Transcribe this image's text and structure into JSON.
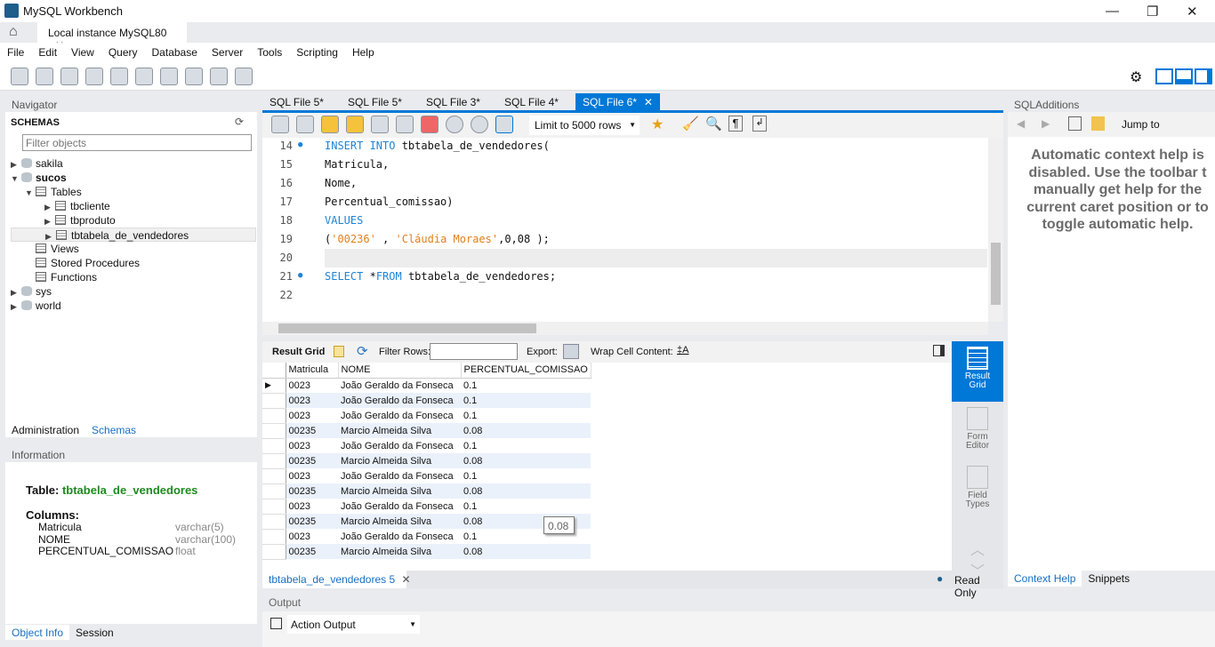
{
  "app": {
    "title": "MySQL Workbench",
    "connection_tab": "Local instance MySQL80"
  },
  "menu": [
    "File",
    "Edit",
    "View",
    "Query",
    "Database",
    "Server",
    "Tools",
    "Scripting",
    "Help"
  ],
  "navigator": {
    "header": "Navigator",
    "schemas_label": "SCHEMAS",
    "filter_placeholder": "Filter objects",
    "tree": {
      "sakila": "sakila",
      "sucos": "sucos",
      "tables": "Tables",
      "t1": "tbcliente",
      "t2": "tbproduto",
      "t3": "tbtabela_de_vendedores",
      "views": "Views",
      "procs": "Stored Procedures",
      "funcs": "Functions",
      "sys": "sys",
      "world": "world"
    },
    "tabs": [
      "Administration",
      "Schemas"
    ]
  },
  "information": {
    "header": "Information",
    "table_label": "Table:",
    "table_name": "tbtabela_de_vendedores",
    "columns_label": "Columns:",
    "columns": [
      {
        "name": "Matricula",
        "type": "varchar(5)"
      },
      {
        "name": "NOME",
        "type": "varchar(100)"
      },
      {
        "name": "PERCENTUAL_COMISSAO",
        "type": "float"
      }
    ],
    "tabs": [
      "Object Info",
      "Session"
    ]
  },
  "sql_tabs": [
    "SQL File 5*",
    "SQL File 5*",
    "SQL File 3*",
    "SQL File 4*",
    "SQL File 6*"
  ],
  "editor_toolbar": {
    "limit": "Limit to 5000 rows"
  },
  "editor": {
    "lines": [
      "14",
      "15",
      "16",
      "17",
      "18",
      "19",
      "20",
      "21",
      "22"
    ],
    "l14a": "INSERT INTO",
    "l14b": " tbtabela_de_vendedores(",
    "l15": "Matricula,",
    "l16": "Nome,",
    "l17": "Percentual_comissao)",
    "l18": "VALUES",
    "l19a": "(",
    "l19b": "'00236'",
    "l19c": " , ",
    "l19d": "'Cláudia Moraes'",
    "l19e": ",0,08 );",
    "l21a": "SELECT",
    "l21b": " *",
    "l21c": "FROM",
    "l21d": " tbtabela_de_vendedores;"
  },
  "result_toolbar": {
    "result_grid": "Result Grid",
    "filter_rows": "Filter Rows:",
    "export": "Export:",
    "wrap": "Wrap Cell Content:"
  },
  "grid": {
    "columns": [
      "Matricula",
      "NOME",
      "PERCENTUAL_COMISSAO"
    ],
    "rows": [
      [
        "0023",
        "João Geraldo da Fonseca",
        "0.1"
      ],
      [
        "0023",
        "João Geraldo da Fonseca",
        "0.1"
      ],
      [
        "0023",
        "João Geraldo da Fonseca",
        "0.1"
      ],
      [
        "00235",
        "Marcio Almeida Silva",
        "0.08"
      ],
      [
        "0023",
        "João Geraldo da Fonseca",
        "0.1"
      ],
      [
        "00235",
        "Marcio Almeida Silva",
        "0.08"
      ],
      [
        "0023",
        "João Geraldo da Fonseca",
        "0.1"
      ],
      [
        "00235",
        "Marcio Almeida Silva",
        "0.08"
      ],
      [
        "0023",
        "João Geraldo da Fonseca",
        "0.1"
      ],
      [
        "00235",
        "Marcio Almeida Silva",
        "0.08"
      ],
      [
        "0023",
        "João Geraldo da Fonseca",
        "0.1"
      ],
      [
        "00235",
        "Marcio Almeida Silva",
        "0.08"
      ]
    ],
    "tooltip": "0.08"
  },
  "result_side": {
    "result_grid": "Result Grid",
    "form_editor": "Form Editor",
    "field_types": "Field Types"
  },
  "result_tab": "tbtabela_de_vendedores 5",
  "read_only": "Read Only",
  "output": {
    "header": "Output",
    "select": "Action Output"
  },
  "sqladditions": {
    "header": "SQLAdditions",
    "jump_to": "Jump to",
    "help_lines": [
      "Automatic context help is",
      "disabled. Use the toolbar t",
      "manually get help for the",
      "current caret position or to",
      "toggle automatic help."
    ],
    "tabs": [
      "Context Help",
      "Snippets"
    ]
  },
  "colors": {
    "accent": "#0078d7",
    "keyword": "#1f84d6",
    "string": "#e0801c",
    "info_table": "#1e8a1e"
  }
}
